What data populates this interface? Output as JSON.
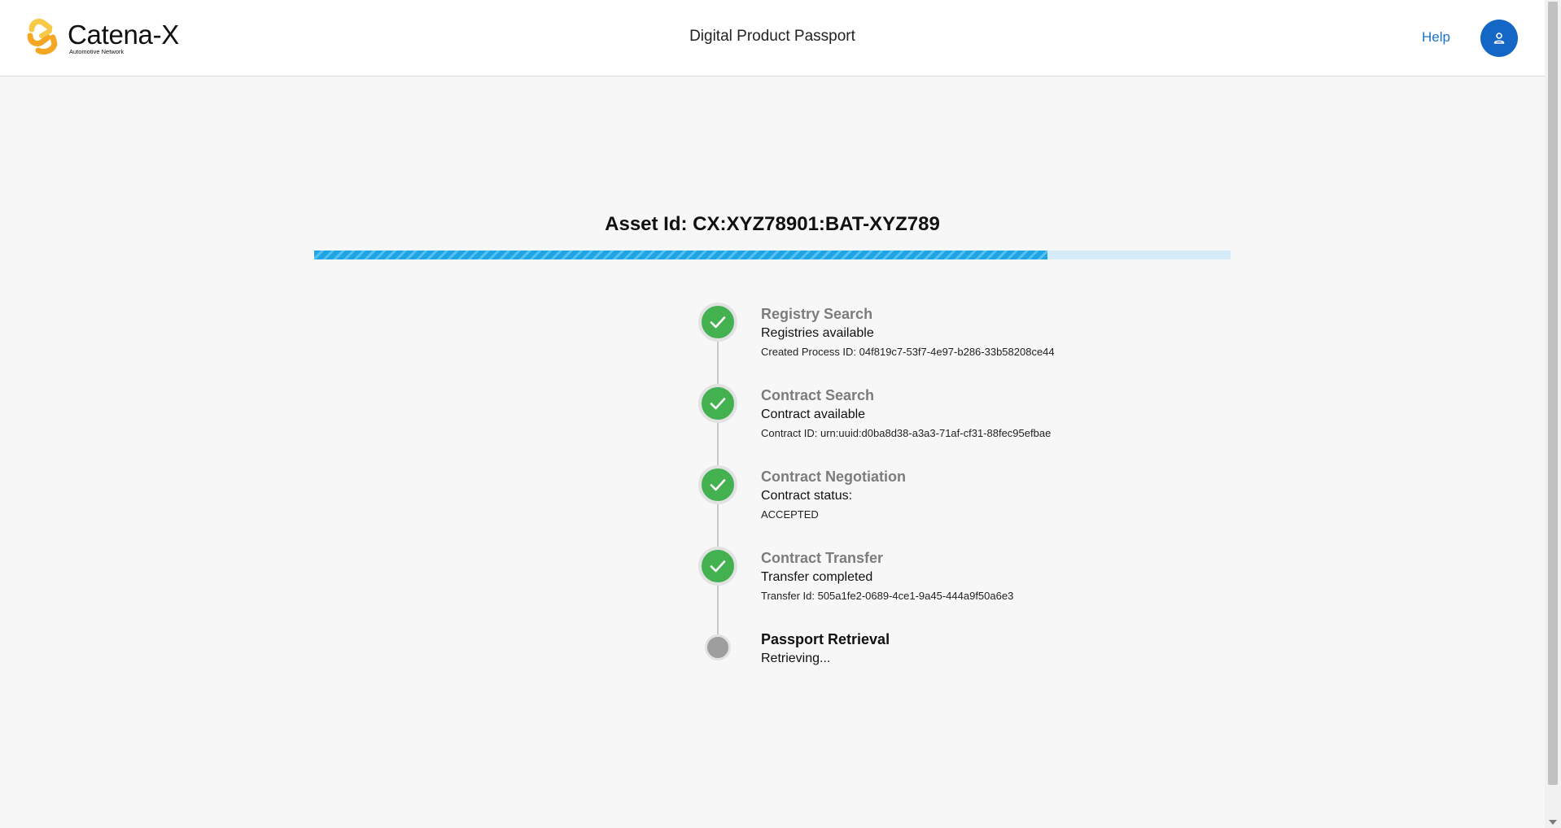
{
  "header": {
    "logo": {
      "name": "Catena-X",
      "subtitle": "Automotive Network"
    },
    "title": "Digital Product Passport",
    "help_label": "Help",
    "avatar_icon": "person-icon"
  },
  "main": {
    "asset_title": "Asset Id: CX:XYZ78901:BAT-XYZ789",
    "progress_fraction": 0.8,
    "steps": [
      {
        "title": "Registry Search",
        "status": "Registries available",
        "detail": "Created Process ID: 04f819c7-53f7-4e97-b286-33b58208ce44",
        "state": "done"
      },
      {
        "title": "Contract Search",
        "status": "Contract available",
        "detail": "Contract ID: urn:uuid:d0ba8d38-a3a3-71af-cf31-88fec95efbae",
        "state": "done"
      },
      {
        "title": "Contract Negotiation",
        "status": "Contract status:",
        "detail": "ACCEPTED",
        "state": "done"
      },
      {
        "title": "Contract Transfer",
        "status": "Transfer completed",
        "detail": "Transfer Id: 505a1fe2-0689-4ce1-9a45-444a9f50a6e3",
        "state": "done"
      },
      {
        "title": "Passport Retrieval",
        "status": "Retrieving...",
        "detail": "",
        "state": "pending"
      }
    ]
  },
  "colors": {
    "brand_blue": "#1467c4",
    "help_link": "#1a73c8",
    "progress_bar": "#1fa4e6",
    "progress_track": "#d5ecf8",
    "step_done": "#44b150",
    "step_pending": "#9e9e9e",
    "logo_orange": "#f5a623",
    "logo_yellow": "#f7c948"
  }
}
